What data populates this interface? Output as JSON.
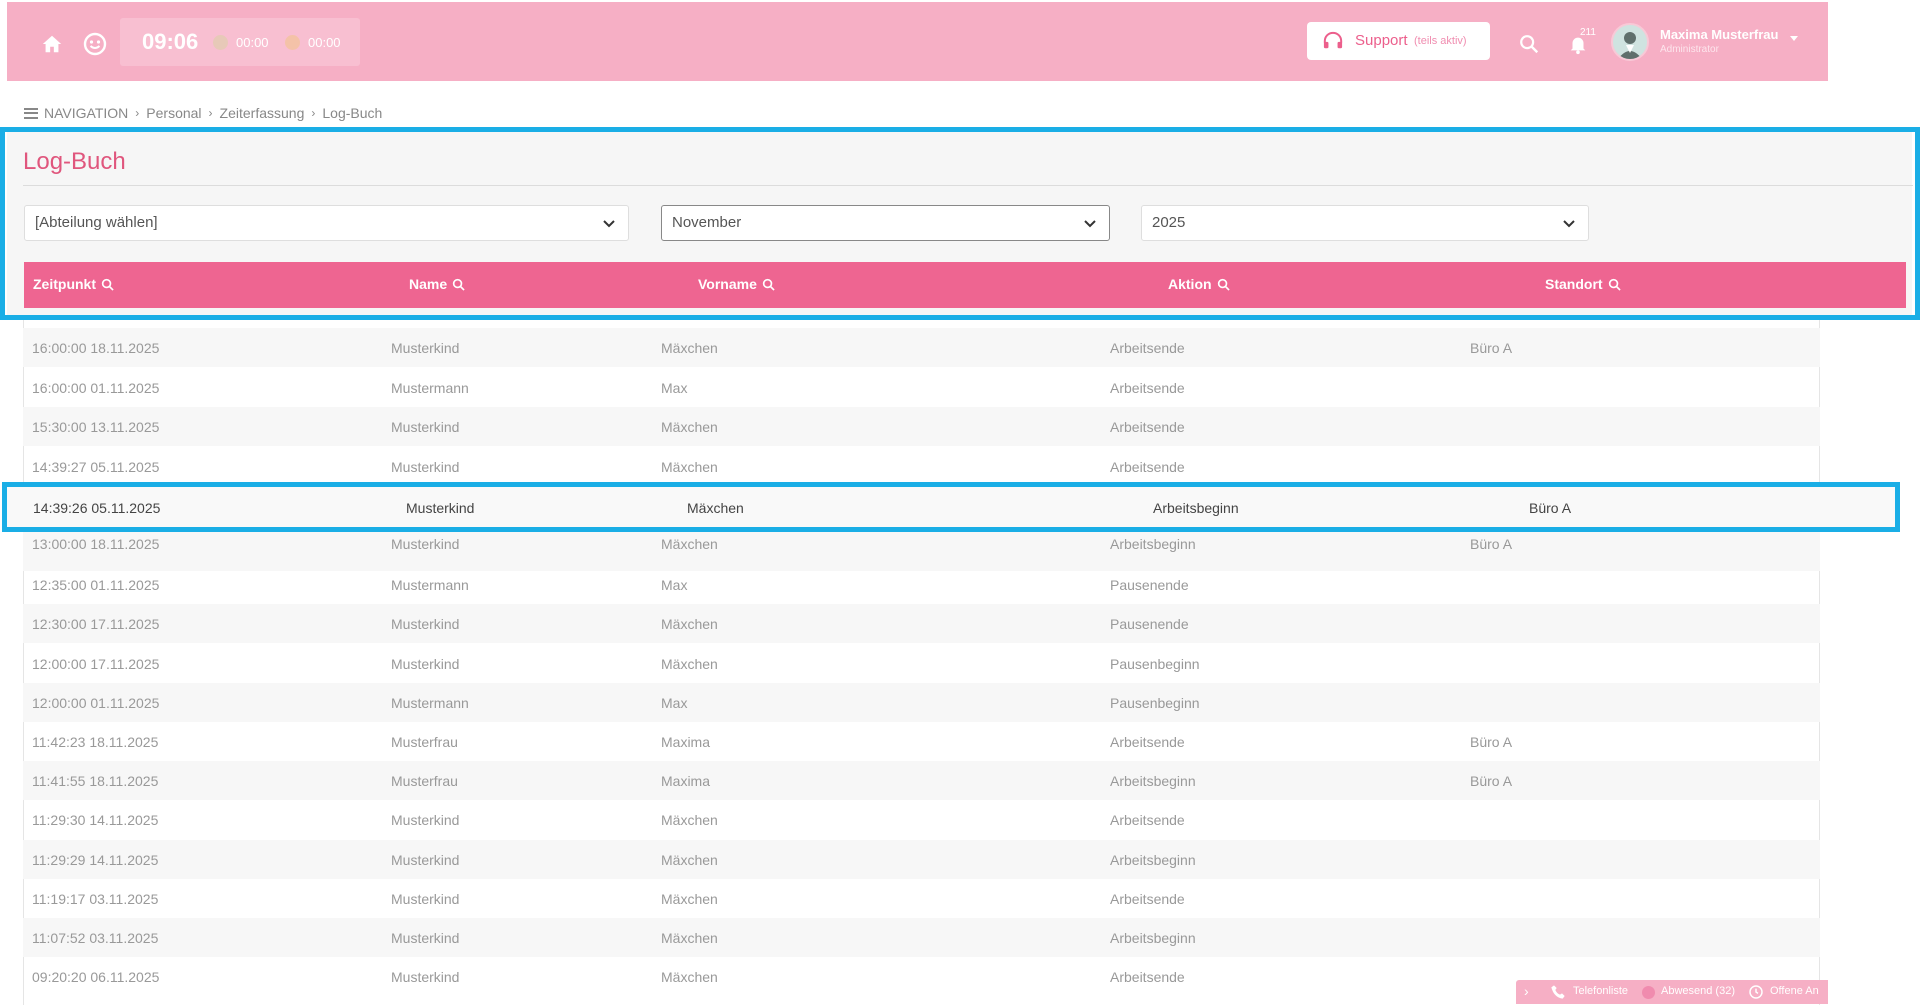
{
  "colors": {
    "brand": "#f6afc5",
    "accent": "#ee6591",
    "title": "#e0567d",
    "highlight": "#1aaee6"
  },
  "topbar": {
    "home_icon": "home-icon",
    "smiley_icon": "smiley-icon",
    "time": "09:06",
    "timer1": "00:00",
    "timer2": "00:00",
    "support_label": "Support",
    "support_sub": "(teils aktiv)",
    "notif_count": "211",
    "user_name": "Maxima Musterfrau",
    "user_role": "Administrator"
  },
  "breadcrumb": [
    "NAVIGATION",
    "Personal",
    "Zeiterfassung",
    "Log-Buch"
  ],
  "page": {
    "title": "Log-Buch",
    "filters": {
      "department": "[Abteilung wählen]",
      "month": "November",
      "year": "2025"
    }
  },
  "table": {
    "columns": [
      "Zeitpunkt",
      "Name",
      "Vorname",
      "Aktion",
      "Standort"
    ],
    "rows": [
      [
        "16:00:00 18.11.2025",
        "Musterkind",
        "Mäxchen",
        "Arbeitsende",
        "Büro A"
      ],
      [
        "16:00:00 01.11.2025",
        "Mustermann",
        "Max",
        "Arbeitsende",
        ""
      ],
      [
        "15:30:00 13.11.2025",
        "Musterkind",
        "Mäxchen",
        "Arbeitsende",
        ""
      ],
      [
        "14:39:27 05.11.2025",
        "Musterkind",
        "Mäxchen",
        "Arbeitsende",
        ""
      ],
      [
        "14:39:26 05.11.2025",
        "Musterkind",
        "Mäxchen",
        "Arbeitsbeginn",
        "Büro A"
      ],
      [
        "13:00:00 18.11.2025",
        "Musterkind",
        "Mäxchen",
        "Arbeitsbeginn",
        "Büro A"
      ],
      [
        "12:35:00 01.11.2025",
        "Mustermann",
        "Max",
        "Pausenende",
        ""
      ],
      [
        "12:30:00 17.11.2025",
        "Musterkind",
        "Mäxchen",
        "Pausenende",
        ""
      ],
      [
        "12:00:00 17.11.2025",
        "Musterkind",
        "Mäxchen",
        "Pausenbeginn",
        ""
      ],
      [
        "12:00:00 01.11.2025",
        "Mustermann",
        "Max",
        "Pausenbeginn",
        ""
      ],
      [
        "11:42:23 18.11.2025",
        "Musterfrau",
        "Maxima",
        "Arbeitsende",
        "Büro A"
      ],
      [
        "11:41:55 18.11.2025",
        "Musterfrau",
        "Maxima",
        "Arbeitsbeginn",
        "Büro A"
      ],
      [
        "11:29:30 14.11.2025",
        "Musterkind",
        "Mäxchen",
        "Arbeitsende",
        ""
      ],
      [
        "11:29:29 14.11.2025",
        "Musterkind",
        "Mäxchen",
        "Arbeitsbeginn",
        ""
      ],
      [
        "11:19:17 03.11.2025",
        "Musterkind",
        "Mäxchen",
        "Arbeitsende",
        ""
      ],
      [
        "11:07:52 03.11.2025",
        "Musterkind",
        "Mäxchen",
        "Arbeitsbeginn",
        ""
      ],
      [
        "09:20:20 06.11.2025",
        "Musterkind",
        "Mäxchen",
        "Arbeitsende",
        ""
      ]
    ]
  },
  "quickbar": {
    "phone_list": "Telefonliste",
    "absent": "Abwesend (32)",
    "open": "Offene An"
  }
}
